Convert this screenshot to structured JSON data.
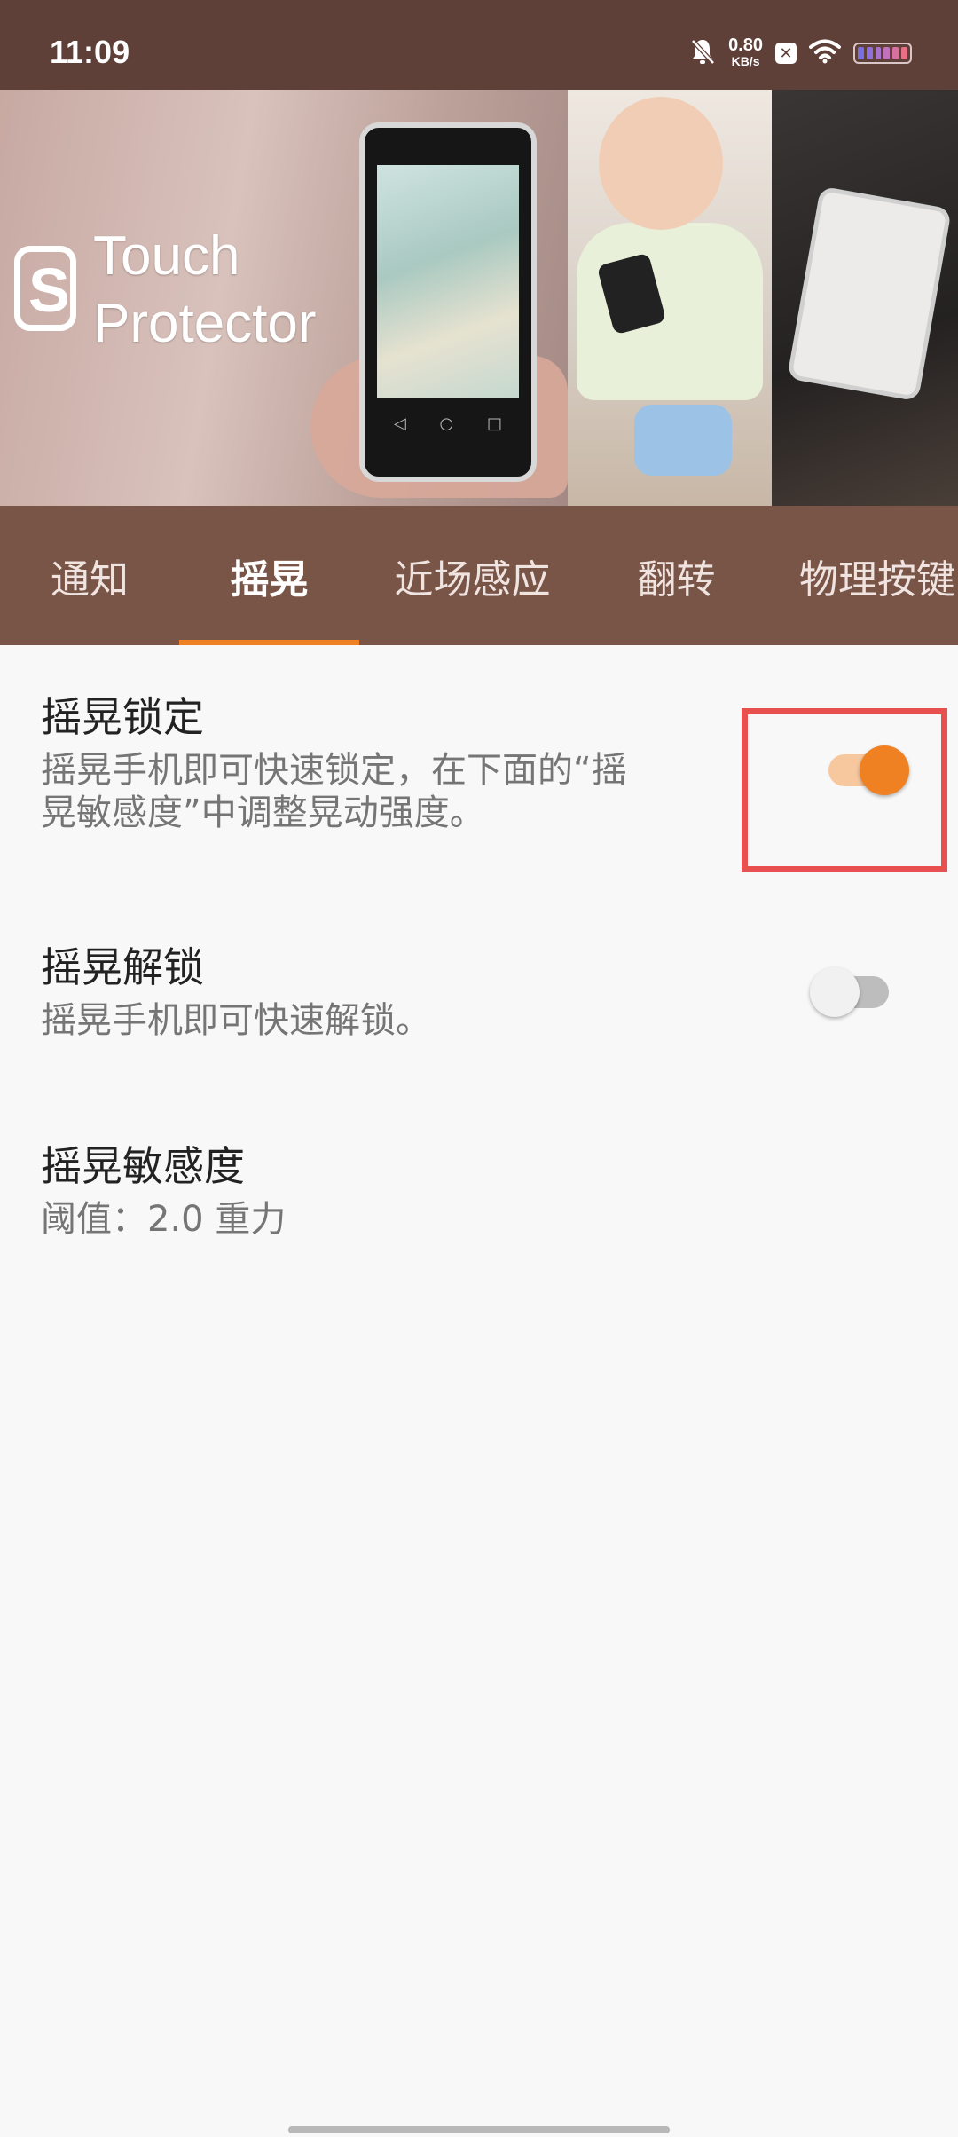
{
  "status_bar": {
    "time": "11:09",
    "net_speed_value": "0.80",
    "net_speed_unit": "KB/s",
    "icons": [
      "bell-off-icon",
      "x-notification-icon",
      "wifi-icon",
      "battery-icon"
    ]
  },
  "banner": {
    "logo_letter": "S",
    "logo_line1": "Touch",
    "logo_line2": "Protector"
  },
  "tabs": [
    {
      "label": "通知",
      "active": false
    },
    {
      "label": "摇晃",
      "active": true
    },
    {
      "label": "近场感应",
      "active": false
    },
    {
      "label": "翻转",
      "active": false
    },
    {
      "label": "物理按键",
      "active": false
    }
  ],
  "settings": [
    {
      "title": "摇晃锁定",
      "summary_line1": "摇晃手机即可快速锁定，在下面的“摇",
      "summary_line2": "晃敏感度”中调整晃动强度。",
      "enabled": true
    },
    {
      "title": "摇晃解锁",
      "summary": "摇晃手机即可快速解锁。",
      "enabled": false
    },
    {
      "title": "摇晃敏感度",
      "summary": "阈值：2.0 重力"
    }
  ],
  "colors": {
    "status_bar": "#5f4038",
    "tab_bar": "#795548",
    "accent": "#f08122",
    "highlight_border": "#e8504f"
  }
}
